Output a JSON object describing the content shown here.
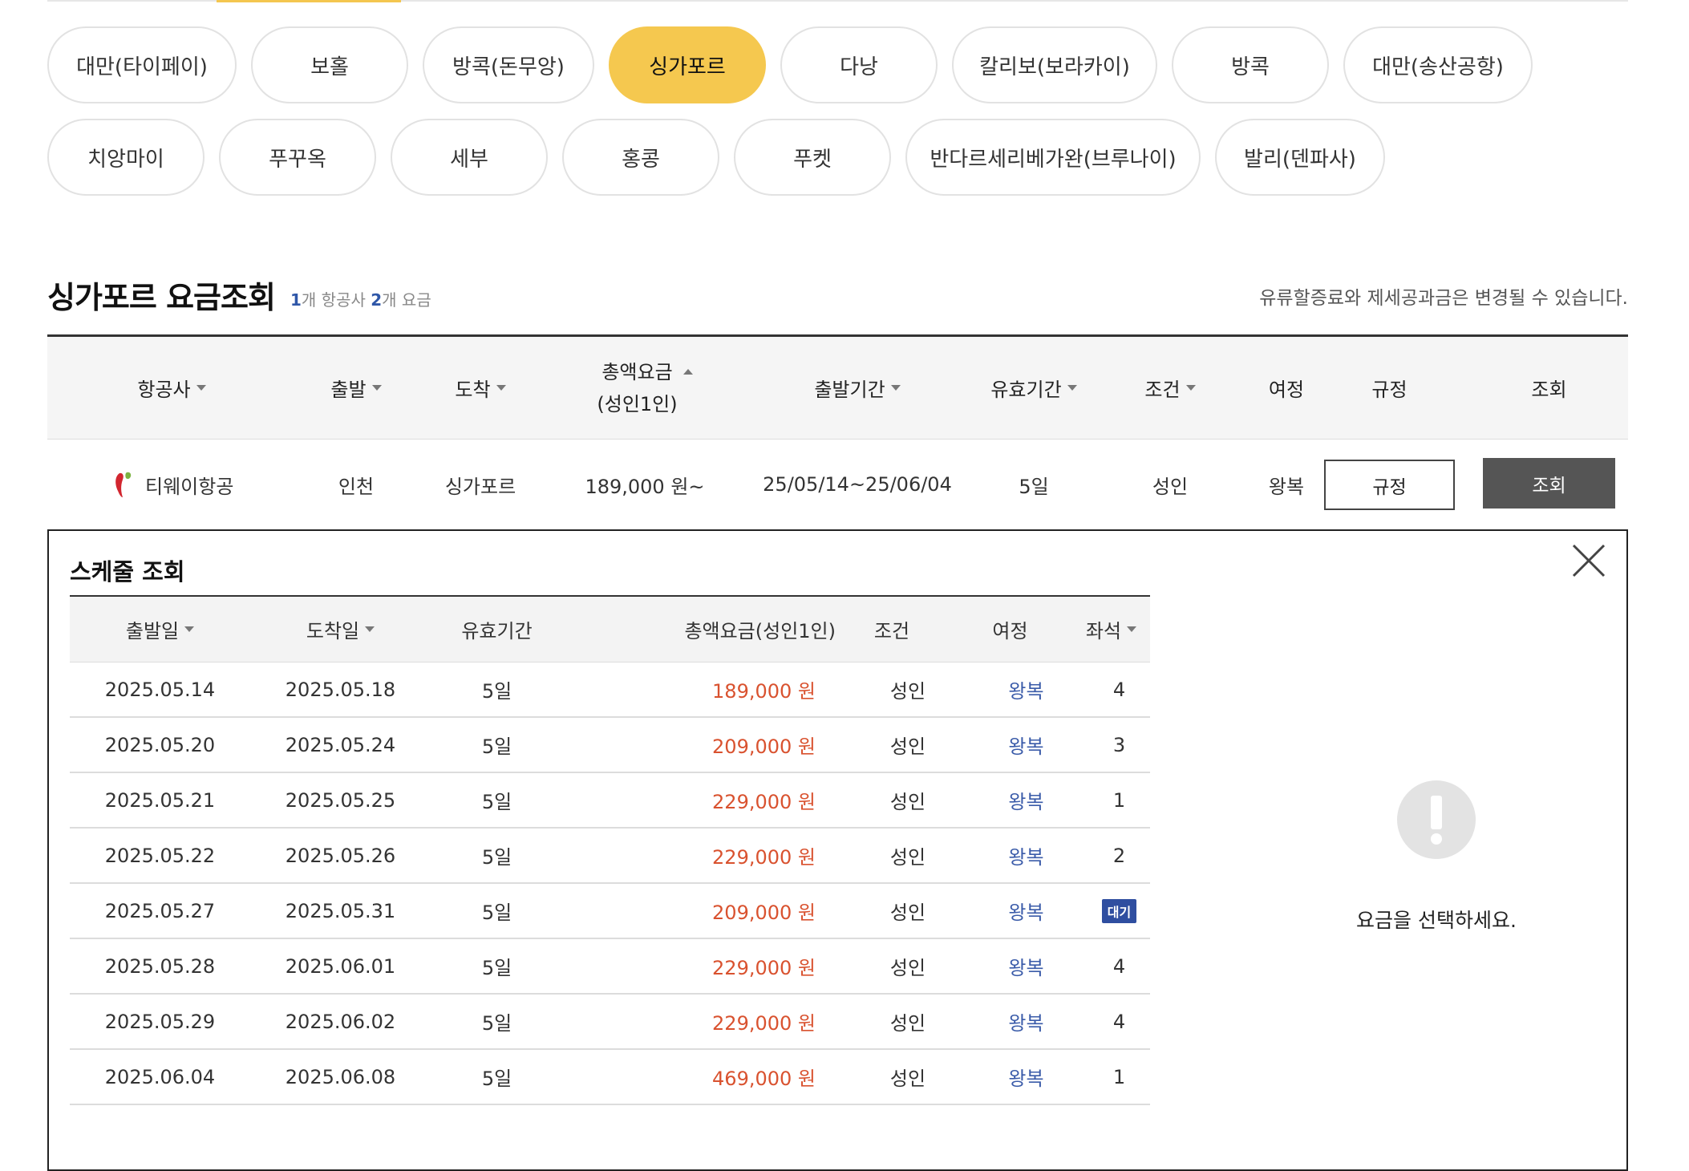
{
  "cities": {
    "row1": [
      "대만(타이페이)",
      "보홀",
      "방콕(돈무앙)",
      "싱가포르",
      "다낭",
      "칼리보(보라카이)",
      "방콕",
      "대만(송산공항)"
    ],
    "row2": [
      "치앙마이",
      "푸꾸옥",
      "세부",
      "홍콩",
      "푸켓",
      "반다르세리베가완(브루나이)",
      "발리(덴파사)"
    ],
    "active": "싱가포르"
  },
  "heading": {
    "title": "싱가포르 요금조회",
    "airline_count": "1",
    "airline_count_suffix": "개 항공사",
    "fare_count": "2",
    "fare_count_suffix": "개 요금",
    "notice": "유류할증료와 제세공과금은 변경될 수 있습니다."
  },
  "fare_table": {
    "headers": {
      "airline": "항공사",
      "departure": "출발",
      "arrival": "도착",
      "total_line1": "총액요금",
      "total_line2": "(성인1인)",
      "period": "출발기간",
      "validity": "유효기간",
      "condition": "조건",
      "trip": "여정",
      "rule": "규정",
      "view": "조회"
    },
    "row": {
      "airline": "티웨이항공",
      "departure": "인천",
      "arrival": "싱가포르",
      "price": "189,000 원~",
      "period": "25/05/14~25/06/04",
      "validity": "5일",
      "condition": "성인",
      "trip": "왕복",
      "rule_button": "규정",
      "view_button": "조회"
    }
  },
  "schedule": {
    "title": "스케줄 조회",
    "headers": {
      "depart_date": "출발일",
      "arrive_date": "도착일",
      "validity": "유효기간",
      "total": "총액요금(성인1인)",
      "condition": "조건",
      "trip": "여정",
      "seats": "좌석"
    },
    "rows": [
      {
        "depart": "2025.05.14",
        "arrive": "2025.05.18",
        "validity": "5일",
        "price": "189,000 원",
        "condition": "성인",
        "trip": "왕복",
        "seats": "4"
      },
      {
        "depart": "2025.05.20",
        "arrive": "2025.05.24",
        "validity": "5일",
        "price": "209,000 원",
        "condition": "성인",
        "trip": "왕복",
        "seats": "3"
      },
      {
        "depart": "2025.05.21",
        "arrive": "2025.05.25",
        "validity": "5일",
        "price": "229,000 원",
        "condition": "성인",
        "trip": "왕복",
        "seats": "1"
      },
      {
        "depart": "2025.05.22",
        "arrive": "2025.05.26",
        "validity": "5일",
        "price": "229,000 원",
        "condition": "성인",
        "trip": "왕복",
        "seats": "2"
      },
      {
        "depart": "2025.05.27",
        "arrive": "2025.05.31",
        "validity": "5일",
        "price": "209,000 원",
        "condition": "성인",
        "trip": "왕복",
        "seats": "대기"
      },
      {
        "depart": "2025.05.28",
        "arrive": "2025.06.01",
        "validity": "5일",
        "price": "229,000 원",
        "condition": "성인",
        "trip": "왕복",
        "seats": "4"
      },
      {
        "depart": "2025.05.29",
        "arrive": "2025.06.02",
        "validity": "5일",
        "price": "229,000 원",
        "condition": "성인",
        "trip": "왕복",
        "seats": "4"
      },
      {
        "depart": "2025.06.04",
        "arrive": "2025.06.08",
        "validity": "5일",
        "price": "469,000 원",
        "condition": "성인",
        "trip": "왕복",
        "seats": "1"
      }
    ],
    "empty_message": "요금을 선택하세요."
  },
  "colors": {
    "accent": "#f5c84f",
    "price": "#d9522f",
    "trip": "#3a5ba9",
    "badge": "#2f4ea0"
  }
}
